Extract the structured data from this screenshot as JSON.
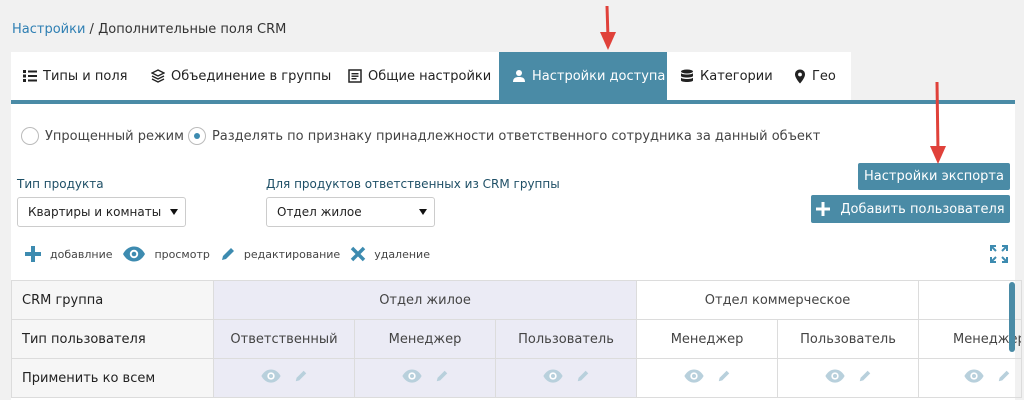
{
  "breadcrumb": {
    "root": "Настройки",
    "separator": " / ",
    "current": "Дополнительные поля CRM"
  },
  "tabs": [
    {
      "label": "Типы и поля",
      "icon": "list-icon",
      "active": false
    },
    {
      "label": "Объединение в группы",
      "icon": "layers-icon",
      "active": false
    },
    {
      "label": "Общие настройки",
      "icon": "document-icon",
      "active": false
    },
    {
      "label": "Настройки доступа",
      "icon": "user-icon",
      "active": true
    },
    {
      "label": "Категории",
      "icon": "database-icon",
      "active": false
    },
    {
      "label": "Гео",
      "icon": "map-pin-icon",
      "active": false
    }
  ],
  "mode": {
    "simple": "Упрощенный режим",
    "split": "Разделять по признаку принадлежности ответственного сотрудника за данный объект",
    "selected": "split"
  },
  "filters": {
    "product_type_label": "Тип продукта",
    "product_type_value": "Квартиры и комнаты",
    "crm_group_label": "Для продуктов ответственных из CRM группы",
    "crm_group_value": "Отдел жилое"
  },
  "buttons": {
    "export": "Настройки экспорта",
    "add_user": "Добавить пользователя"
  },
  "legend": {
    "add": "добавлние",
    "view": "просмотр",
    "edit": "редактирование",
    "delete": "удаление"
  },
  "grid": {
    "row_labels": {
      "crm_group": "CRM группа",
      "user_type": "Тип пользователя",
      "apply_all": "Применить ко всем"
    },
    "groups": [
      "Отдел жилое",
      "Отдел коммерческое"
    ],
    "user_types": [
      "Ответственный",
      "Менеджер",
      "Пользователь",
      "Менеджер",
      "Пользователь",
      "Менеджер"
    ]
  },
  "colors": {
    "accent": "#4a8ba6",
    "link": "#2e7fb3",
    "arrow": "#e0413a",
    "shade": "#ebebf5"
  }
}
